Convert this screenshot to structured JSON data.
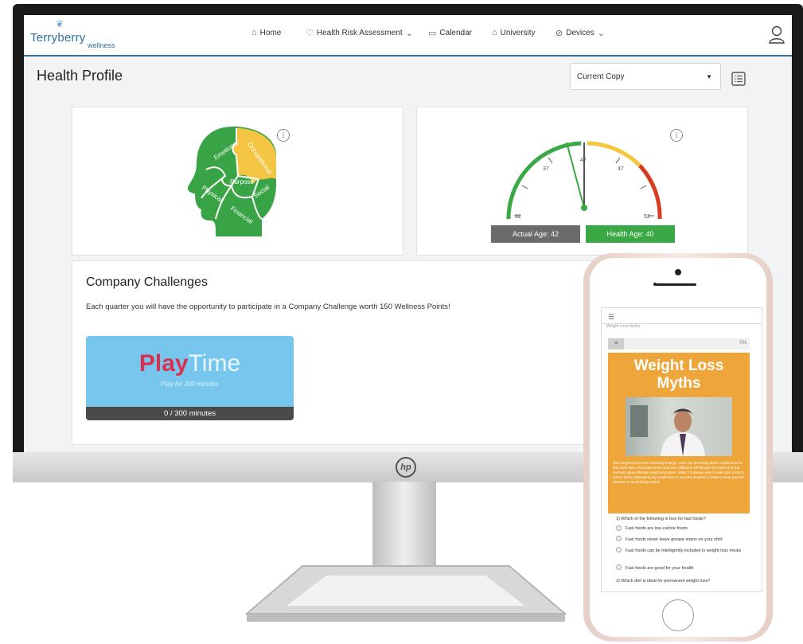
{
  "brand": {
    "name": "Terryberry",
    "sub": "wellness"
  },
  "nav": {
    "home": "Home",
    "hra": "Health Risk Assessment",
    "calendar": "Calendar",
    "university": "University",
    "devices": "Devices"
  },
  "page": {
    "title": "Health Profile",
    "select_value": "Current Copy"
  },
  "puzzle": {
    "emotional": "Emotional",
    "occupational": "Occupational",
    "purpose": "Purpose",
    "physical": "Physical",
    "social": "Social",
    "financial": "Financial",
    "colors": {
      "green": "#39a445",
      "yellow": "#f4c542"
    }
  },
  "gauge": {
    "ticks": [
      "32",
      "37",
      "42",
      "47",
      "52"
    ],
    "actual_age_label": "Actual Age: 42",
    "health_age_label": "Health Age: 40",
    "colors": {
      "actual": "#6b6b6b",
      "health": "#3aa845",
      "green": "#3aa845",
      "yellow": "#f3c63e",
      "red": "#d83b1f"
    }
  },
  "challenges": {
    "title": "Company Challenges",
    "description": "Each quarter you will have the opportunity to participate in a Company Challenge worth 150 Wellness Points!",
    "play_word": "Play",
    "time_word": "Time",
    "play_sub": "Play for 300 minutes",
    "progress_text": "0 / 300 minutes",
    "progress": 0
  },
  "phone": {
    "header_text": "Weight Loss Myths",
    "percent": "0%",
    "banner_title_1": "Weight Loss",
    "banner_title_2": "Myths",
    "banner_text": "New weight loss trends constantly emerge, each one promising better results than the last. Over time, it becomes more and more difficult to sift through the myths and find the facts about effective weight loss plans. While it is always wise to seek your doctor's advice before attempting any weight loss or exercise program, it helps to keep yourself informed to avoid being misled.",
    "q1": "1) Which of the following is true for fast foods?",
    "options": [
      "Fast foods are low-calorie foods",
      "Fast foods never leave grease stains on your shirt",
      "Fast foods can be intelligently included in weight loss meals",
      "Fast foods are good for your health"
    ],
    "q2": "2) Which diet is ideal for permanent weight loss?"
  }
}
